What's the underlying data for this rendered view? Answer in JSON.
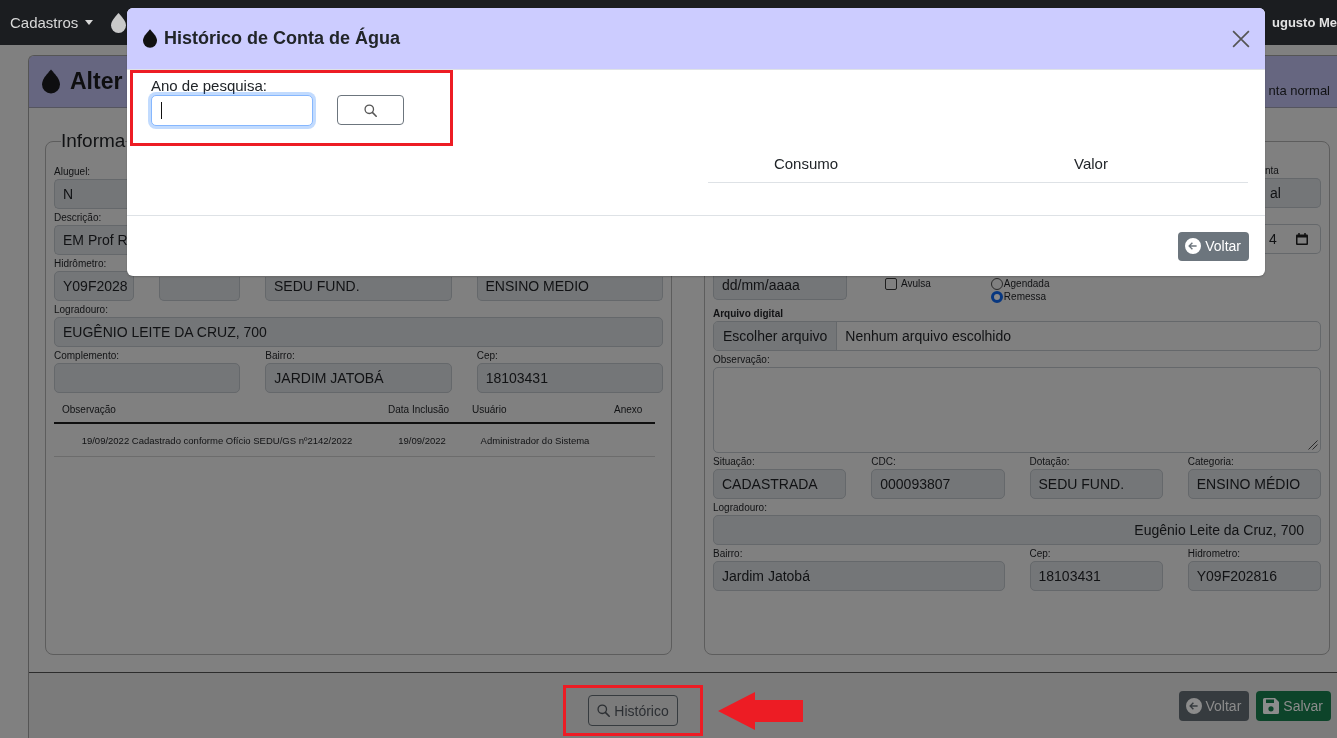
{
  "navbar": {
    "menu_label": "Cadastros",
    "user_name": "ugusto Me"
  },
  "page_header": {
    "title": "Alter",
    "account_type": "nta normal"
  },
  "left_panel": {
    "legend": "Informa",
    "rows": [
      {
        "kind": "cut",
        "fields": [
          {
            "kind": "text",
            "label": "Aluguel:",
            "value": "N"
          }
        ]
      },
      {
        "kind": "cut",
        "fields": [
          {
            "kind": "text",
            "label": "Descrição:",
            "value": "EM Prof R"
          }
        ]
      },
      {
        "kind": "meter",
        "fields": [
          {
            "kind": "text",
            "label": "Hidrômetro:",
            "value": "Y09F2028"
          },
          {
            "kind": "text"
          },
          {
            "kind": "text",
            "value": "SEDU FUND."
          },
          {
            "kind": "text",
            "value": "ENSINO MEDIO"
          }
        ]
      },
      {
        "kind": "full",
        "fields": [
          {
            "kind": "text",
            "label": "Logradouro:",
            "value": "EUGÊNIO LEITE DA CRUZ, 700"
          }
        ]
      },
      {
        "kind": "thirds",
        "fields": [
          {
            "kind": "text",
            "label": "Complemento:"
          },
          {
            "kind": "text",
            "label": "Bairro:",
            "value": "JARDIM JATOBÁ"
          },
          {
            "kind": "text",
            "label": "Cep:",
            "value": "18103431"
          }
        ]
      }
    ],
    "table": {
      "columns": [
        "Observação",
        "Data Inclusão",
        "Usuário",
        "Anexo"
      ],
      "rows": [
        {
          "cells": [
            "19/09/2022 Cadastrado conforme Ofício SEDU/GS nº2142/2022",
            "19/09/2022",
            "Administrador do Sistema"
          ]
        }
      ]
    }
  },
  "right_panel": {
    "rows": [
      {
        "kind": "cut-right",
        "fields": [
          {
            "kind": "text",
            "label": "nta",
            "value": "al"
          },
          {
            "kind": "date",
            "value": "4",
            "disabled": false
          }
        ]
      },
      {
        "kind": "options",
        "fields": [
          {
            "kind": "date",
            "placeholder": "dd/mm/aaaa",
            "disabled": true
          },
          {
            "kind": "checkbox",
            "label": "Avulsa",
            "checked": false
          },
          {
            "kind": "radio",
            "options": [
              {
                "label": "Agendada",
                "selected": false
              },
              {
                "label": "Remessa",
                "selected": true
              }
            ]
          }
        ]
      },
      {
        "kind": "full",
        "fields": [
          {
            "kind": "file",
            "label": "Arquivo digital",
            "button": "Escolher arquivo",
            "value": "Nenhum arquivo escolhido"
          }
        ]
      },
      {
        "kind": "full",
        "fields": [
          {
            "kind": "textarea",
            "label": "Observação:"
          }
        ]
      },
      {
        "kind": "quarters",
        "fields": [
          {
            "kind": "text",
            "label": "Situação:",
            "value": "CADASTRADA"
          },
          {
            "kind": "text",
            "label": "CDC:",
            "value": "000093807"
          },
          {
            "kind": "text",
            "label": "Dotação:",
            "value": "SEDU FUND."
          },
          {
            "kind": "text",
            "label": "Categoria:",
            "value": "ENSINO MÉDIO"
          }
        ]
      },
      {
        "kind": "full-right",
        "fields": [
          {
            "kind": "text",
            "label": "Logradouro:",
            "value": "Eugênio Leite da Cruz, 700"
          }
        ]
      },
      {
        "kind": "wide-first",
        "fields": [
          {
            "kind": "text",
            "label": "Bairro:",
            "value": "Jardim Jatobá"
          },
          {
            "kind": "text",
            "label": "Cep:",
            "value": "18103431"
          },
          {
            "kind": "text",
            "label": "Hidrometro:",
            "value": "Y09F202816"
          }
        ]
      }
    ]
  },
  "footer": {
    "history_button": "Histórico",
    "buttons": [
      {
        "kind": "back",
        "label": "Voltar"
      },
      {
        "kind": "save",
        "label": "Salvar"
      }
    ]
  },
  "modal": {
    "title": "Histórico de Conta de Água",
    "search": {
      "label": "Ano de pesquisa:",
      "focused": true
    },
    "table": {
      "columns": [
        "Consumo",
        "Valor"
      ]
    },
    "buttons": [
      {
        "kind": "back",
        "label": "Voltar"
      }
    ]
  }
}
